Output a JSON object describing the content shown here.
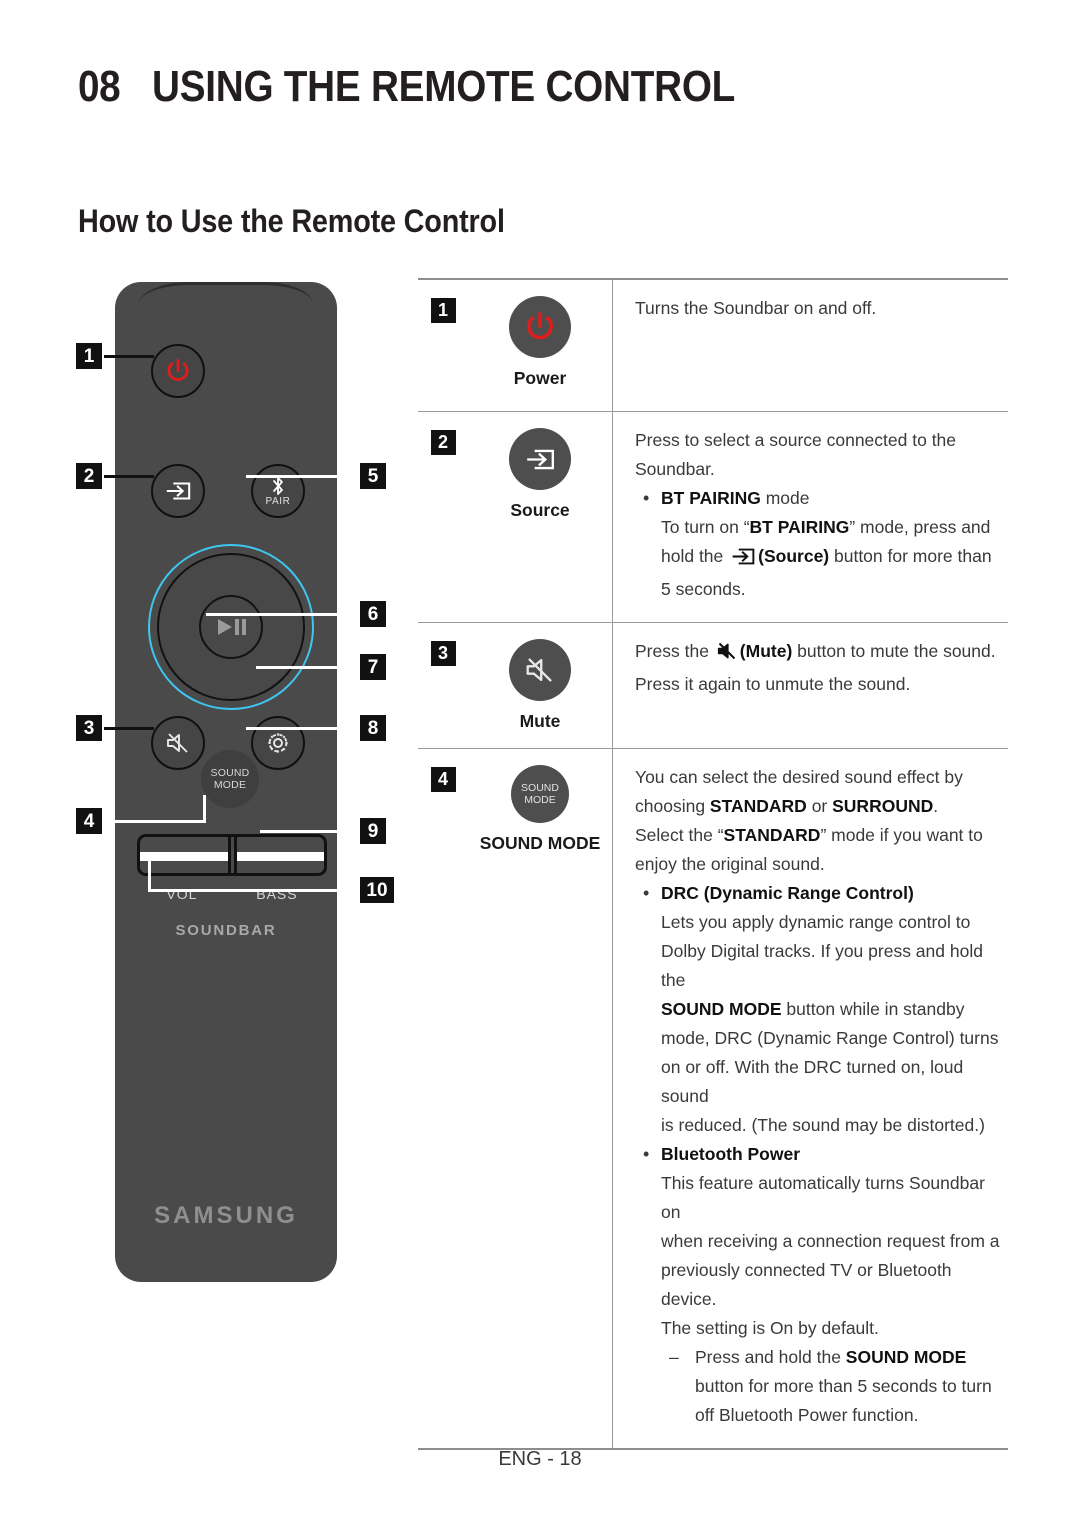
{
  "header": {
    "chapter_number": "08",
    "chapter_title": "USING THE REMOTE CONTROL",
    "section_title": "How to Use the Remote Control"
  },
  "remote": {
    "sound_mode_line1": "SOUND",
    "sound_mode_line2": "MODE",
    "pair_label": "PAIR",
    "vol_label": "VOL",
    "bass_label": "BASS",
    "product_label": "SOUNDBAR",
    "brand": "SAMSUNG",
    "callouts": {
      "c1": "1",
      "c2": "2",
      "c3": "3",
      "c4": "4",
      "c5": "5",
      "c6": "6",
      "c7": "7",
      "c8": "8",
      "c9": "9",
      "c10": "10"
    }
  },
  "table": {
    "rows": [
      {
        "num": "1",
        "button_label": "Power",
        "icon": "power-icon",
        "desc_line1": "Turns the Soundbar on and off."
      },
      {
        "num": "2",
        "button_label": "Source",
        "icon": "source-icon",
        "desc_line1": "Press to select a source connected to the",
        "desc_line2": "Soundbar.",
        "bullet_title": "BT PAIRING",
        "bullet_title_tail": " mode",
        "bullet_body_a": "To turn on “",
        "bullet_body_b": "BT PAIRING",
        "bullet_body_c": "” mode, press and",
        "bullet_body_d": "hold the ",
        "bullet_body_e": "(Source)",
        "bullet_body_f": " button for more than",
        "bullet_body_g": "5 seconds."
      },
      {
        "num": "3",
        "button_label": "Mute",
        "icon": "mute-icon",
        "desc_a": "Press the ",
        "desc_b": "(Mute)",
        "desc_c": " button to mute the sound.",
        "desc_d": "Press it again to unmute the sound."
      },
      {
        "num": "4",
        "button_label": "SOUND MODE",
        "icon": "sound-mode-icon",
        "p1_a": "You can select the desired sound effect by",
        "p1_b": "choosing ",
        "p1_bold1": "STANDARD",
        "p1_c": " or ",
        "p1_bold2": "SURROUND",
        "p1_d": ".",
        "p2_a": "Select the “",
        "p2_bold": "STANDARD",
        "p2_b": "” mode if you want to",
        "p2_c": "enjoy the original sound.",
        "bullet1_title": "DRC (Dynamic Range Control)",
        "b1_l1": "Lets you apply dynamic range control to",
        "b1_l2": "Dolby Digital tracks. If you press and hold the",
        "b1_l3_bold": "SOUND MODE",
        "b1_l3_rest": " button while in standby",
        "b1_l4": "mode, DRC (Dynamic Range Control) turns",
        "b1_l5": "on or off. With the DRC turned on, loud sound",
        "b1_l6": "is reduced. (The sound may be distorted.)",
        "bullet2_title": "Bluetooth Power",
        "b2_l1": "This feature automatically turns Soundbar on",
        "b2_l2": "when receiving a connection request from a",
        "b2_l3": "previously connected TV or Bluetooth device.",
        "b2_l4": "The setting is On by default.",
        "b2_sub_a": "Press and hold the ",
        "b2_sub_bold": "SOUND MODE",
        "b2_sub_b": "button for more than 5 seconds to turn",
        "b2_sub_c": "off Bluetooth Power function."
      }
    ]
  },
  "footer": {
    "page_label": "ENG - 18"
  },
  "colors": {
    "power_red": "#e21b1b",
    "ring_cyan": "#3ec6f0",
    "remote_body": "#4a4a4a",
    "rule": "#9a9a9a"
  }
}
